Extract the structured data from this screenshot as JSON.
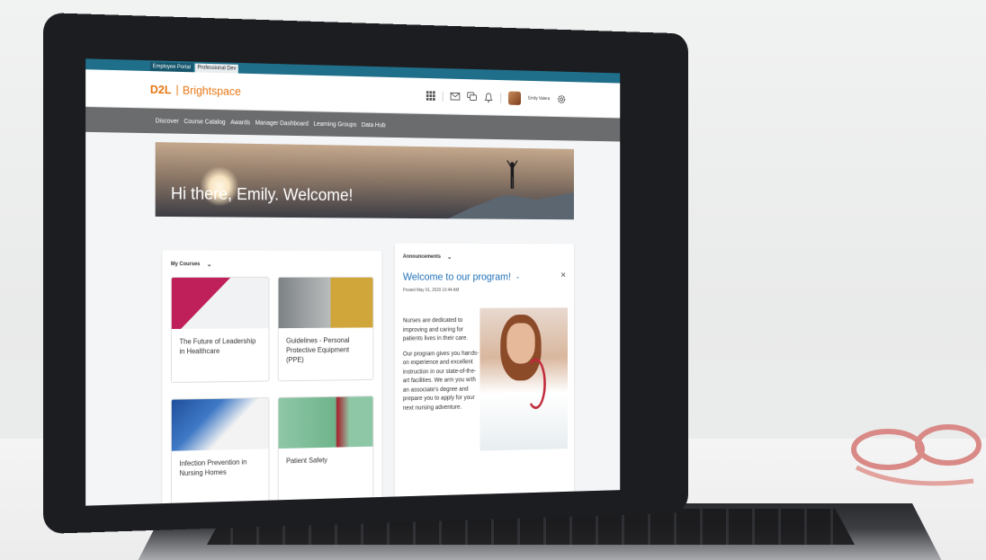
{
  "env_tabs": [
    "Employee Portal",
    "Professional Dev"
  ],
  "brand": {
    "d2l": "D2L",
    "product": "Brightspace",
    "accent": "#e87511"
  },
  "header_icons": [
    "grid-icon",
    "mail-icon",
    "chat-icon",
    "bell-icon",
    "gear-icon"
  ],
  "user": {
    "name": "Emily Valera"
  },
  "nav": {
    "items": [
      "Discover",
      "Course Catalog",
      "Awards",
      "Manager Dashboard",
      "Learning Groups",
      "Data Hub"
    ]
  },
  "hero": {
    "title": "Hi there, Emily. Welcome!"
  },
  "courses": {
    "label": "My Courses",
    "items": [
      {
        "title": "The Future of Leadership in Healthcare"
      },
      {
        "title": "Guidelines - Personal Protective Equipment (PPE)"
      },
      {
        "title": "Infection Prevention in Nursing Homes"
      },
      {
        "title": "Patient Safety"
      }
    ]
  },
  "announcements": {
    "label": "Announcements",
    "title": "Welcome to our program!",
    "posted": "Posted May 01, 2020 10:44 AM",
    "paragraphs": [
      "Nurses are dedicated to improving and caring for patients lives in their care.",
      "Our program gives you hands-on experience and excellent instruction in our state-of-the-art facilities. We arm you with an associate's degree and prepare you to apply for your next nursing adventure."
    ]
  }
}
